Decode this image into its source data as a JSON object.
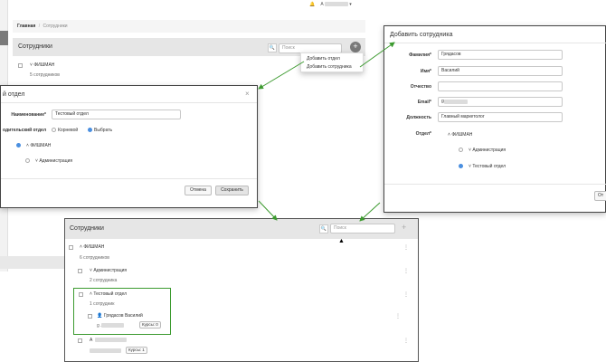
{
  "topbar": {
    "user_prefix": "A",
    "caret": "▾"
  },
  "breadcrumb": {
    "home": "Главная",
    "sep": "/",
    "current": "Сотрудники"
  },
  "bg_panel": {
    "title": "Сотрудники",
    "search_placeholder": "Поиск",
    "root_label": "ФИШМАН",
    "root_count": "5 сотрудников",
    "menu": [
      "Добавить отдел",
      "Добавить сотрудника"
    ]
  },
  "dept_dialog": {
    "title": "й отдел",
    "close": "×",
    "name_label": "Наименование*",
    "name_value": "Тестовый отдел",
    "parent_label": "одительский отдел",
    "opt_root": "Корневой",
    "opt_select": "Выбрать",
    "tree_root": "ФИШМАН",
    "tree_child": "Администрация",
    "cancel": "Отмена",
    "save": "Сохранить"
  },
  "emp_dialog": {
    "title": "Добавить сотрудника",
    "fields": [
      {
        "label": "Фамилия*",
        "value": "Грядасов"
      },
      {
        "label": "Имя*",
        "value": "Василий"
      },
      {
        "label": "Отчество",
        "value": ""
      },
      {
        "label": "Email*",
        "value": "g .com"
      },
      {
        "label": "Должность",
        "value": "Главный маркетолог"
      }
    ],
    "dept_label": "Отдел*",
    "tree_root": "ФИШМАН",
    "tree_child1": "Администрация",
    "tree_child2": "Тестовый отдел",
    "cancel_partial": "От"
  },
  "result_panel": {
    "title": "Сотрудники",
    "search_placeholder": "Поиск",
    "add": "+",
    "root_label": "ФИШМАН",
    "root_count": "6 сотрудников",
    "admin_label": "Администрация",
    "admin_count": "2 сотрудника",
    "test_label": "Тестовый отдел",
    "test_count": "1 сотрудник",
    "emp_name": "Грядасов Василий",
    "emp_email": "g .com",
    "emp_courses": "Курсы: 0",
    "other_prefix": "А",
    "other_courses": "Курсы: 1"
  },
  "colors": {
    "arrow": "#3c9a2f",
    "highlight": "#3c9a2f",
    "accent": "#4a8fe0"
  }
}
